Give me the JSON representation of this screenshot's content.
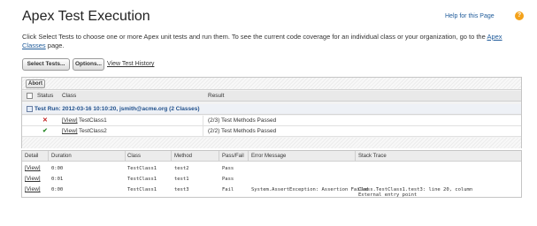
{
  "page": {
    "title": "Apex Test Execution",
    "help_link": "Help for this Page",
    "intro_text": "Click Select Tests to choose one or more Apex unit tests and run them. To see the current code coverage for an individual class or your organization, go to the",
    "intro_link": "Apex Classes",
    "intro_suffix": "page."
  },
  "toolbar": {
    "select_tests": "Select Tests...",
    "options": "Options...",
    "view_history": "View Test History"
  },
  "run_panel": {
    "abort": "Abort",
    "headers": {
      "status": "Status",
      "class": "Class",
      "result": "Result"
    },
    "group_label": "Test Run: 2012-03-16 10:10:20, jsmith@acme.org (2 Classes)",
    "rows": [
      {
        "status": "fail",
        "view": "[View]",
        "class": "TestClass1",
        "result": "(2/3) Test Methods Passed"
      },
      {
        "status": "pass",
        "view": "[View]",
        "class": "TestClass2",
        "result": "(2/2) Test Methods Passed"
      }
    ]
  },
  "detail_table": {
    "headers": {
      "detail": "Detail",
      "duration": "Duration",
      "class": "Class",
      "method": "Method",
      "pass_fail": "Pass/Fail",
      "error": "Error Message",
      "stack": "Stack Trace"
    },
    "rows": [
      {
        "view": "[View]",
        "duration": "0:00",
        "class": "TestClass1",
        "method": "test2",
        "pass_fail": "Pass",
        "error": "",
        "stack": ""
      },
      {
        "view": "[View]",
        "duration": "0:01",
        "class": "TestClass1",
        "method": "test1",
        "pass_fail": "Pass",
        "error": "",
        "stack": ""
      },
      {
        "view": "[View]",
        "duration": "0:00",
        "class": "TestClass1",
        "method": "test3",
        "pass_fail": "Fail",
        "error": "System.AssertException: Assertion Failed",
        "stack": "Class.TestClass1.test3: line 20, column",
        "stack2": "External entry point"
      }
    ]
  },
  "colors": {
    "link": "#1f5b9a",
    "fail_mark": "#c21b1b",
    "pass_mark": "#2a8a2a",
    "help_icon": "#f4a21a"
  },
  "icons": {
    "help": "help-icon",
    "fail": "x-icon",
    "pass": "check-icon"
  }
}
